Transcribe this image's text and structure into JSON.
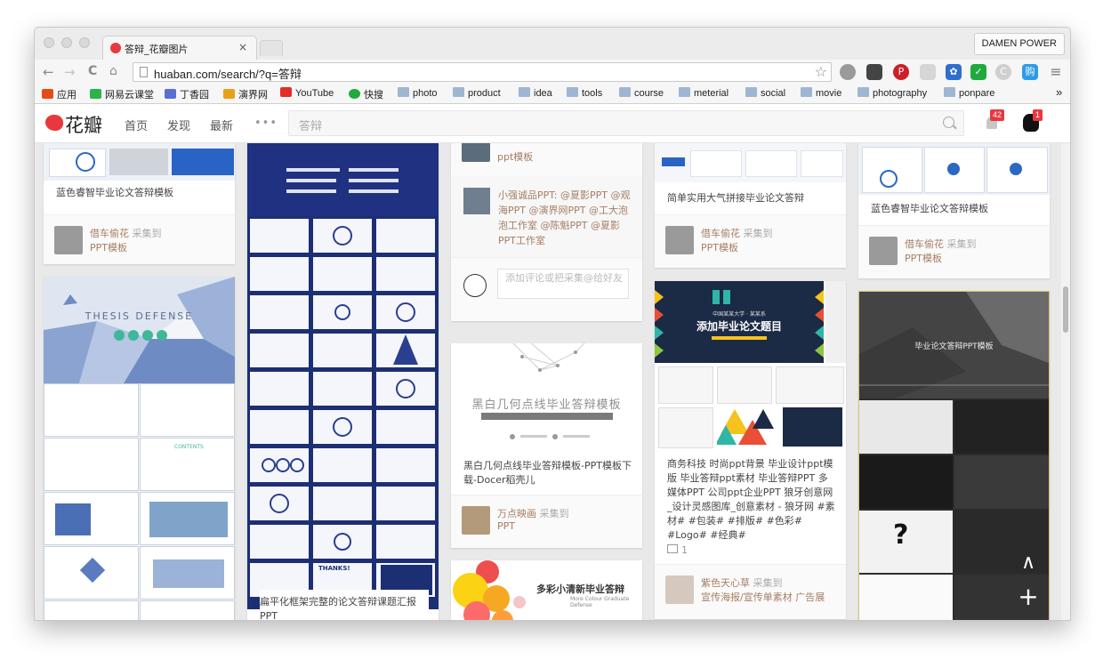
{
  "browser": {
    "tab_title": "答辩_花瓣图片",
    "tab_close": "×",
    "profile": "DAMEN POWER",
    "url": "huaban.com/search/?q=答辩",
    "nav": {
      "back": "←",
      "forward": "→",
      "reload": "C",
      "home": "⌂"
    },
    "star": "☆",
    "extensions": [
      {
        "name": "globe-icon",
        "color": "#8a8a8a"
      },
      {
        "name": "hand-icon",
        "color": "#555555"
      },
      {
        "name": "pinterest-icon",
        "color": "#cb2027"
      },
      {
        "name": "shield-icon",
        "color": "#d0d0d0"
      },
      {
        "name": "paw-icon",
        "color": "#2d6fd0"
      },
      {
        "name": "adblock-icon",
        "color": "#1faa3d"
      },
      {
        "name": "copyright-icon",
        "color": "#bbbbbb"
      },
      {
        "name": "gou-icon",
        "color": "#2f9be8"
      },
      {
        "name": "menu-icon",
        "color": "#777777"
      }
    ],
    "bookmarks": [
      {
        "label": "应用",
        "icon": "apps-icon",
        "color": "#e64a19"
      },
      {
        "label": "网易云课堂",
        "icon": "cloud-class-icon",
        "color": "#2db34a"
      },
      {
        "label": "丁香园",
        "icon": "dxy-icon",
        "color": "#5b6fcf"
      },
      {
        "label": "演界网",
        "icon": "yanjie-icon",
        "color": "#e8a21a"
      },
      {
        "label": "YouTube",
        "icon": "youtube-icon",
        "color": "#e52d27"
      },
      {
        "label": "快搜",
        "icon": "kuaisou-icon",
        "color": "#1faa3d"
      },
      {
        "label": "photo",
        "icon": "folder-icon"
      },
      {
        "label": "product",
        "icon": "folder-icon"
      },
      {
        "label": "idea",
        "icon": "folder-icon"
      },
      {
        "label": "tools",
        "icon": "folder-icon"
      },
      {
        "label": "course",
        "icon": "folder-icon"
      },
      {
        "label": "meterial",
        "icon": "folder-icon"
      },
      {
        "label": "social",
        "icon": "folder-icon"
      },
      {
        "label": "movie",
        "icon": "folder-icon"
      },
      {
        "label": "photography",
        "icon": "folder-icon"
      },
      {
        "label": "ponpare",
        "icon": "folder-icon"
      }
    ],
    "bookmarks_more": "»"
  },
  "huaban": {
    "logo": "花瓣",
    "nav": [
      "首页",
      "发现",
      "最新"
    ],
    "more": "•••",
    "search_placeholder": "答辩",
    "notif_count": "42",
    "msg_count": "1",
    "brand_color": "#e8383e"
  },
  "pins": {
    "c1a": {
      "caption": "蓝色睿智毕业论文答辩模板",
      "user": "借车偷花",
      "action": "采集到",
      "board": "PPT模板"
    },
    "c1b": {
      "headline": "THESIS DEFENSE",
      "sub": "CONTENTS"
    },
    "c2a": {
      "caption": "扁平化框架完整的论文答辩课题汇报PPT",
      "thanks": "THANKS!"
    },
    "c3a": {
      "board": "ppt模板"
    },
    "c3b": {
      "comment": "小强诚品PPT: @夏影PPT @观海PPT @演界网PPT @工大泡泡工作室 @陈魁PPT @夏影PPT工作室"
    },
    "c3c": {
      "placeholder": "添加评论或把采集@给好友"
    },
    "c3d": {
      "title": "黑白几何点线毕业答辩模板",
      "caption": "黑白几何点线毕业答辩模板-PPT模板下载-Docer稻壳儿",
      "user": "万点映画",
      "action": "采集到",
      "board": "PPT"
    },
    "c3e": {
      "title": "多彩小清新毕业答辩",
      "sub": "More Colour Graduate Defense"
    },
    "c4a": {
      "caption": "简单实用大气拼接毕业论文答辩",
      "user": "借车偷花",
      "action": "采集到",
      "board": "PPT模板"
    },
    "c4b": {
      "title": "添加毕业论文题目",
      "school": "中国某某大学 · 某某系",
      "caption": "商务科技 时尚ppt背景 毕业设计ppt模版 毕业答辩ppt素材 毕业答辩PPT 多媒体PPT 公司ppt企业PPT 狼牙创意网_设计灵感图库_创意素材 - 狼牙网 #素材# #包装# #排版# #色彩# #Logo# #经典#",
      "repins": "1",
      "user": "紫色天心草",
      "action": "采集到",
      "board": "宣传海报/宣传单素材 广告展"
    },
    "c5a": {
      "caption": "蓝色睿智毕业论文答辩模板",
      "user": "借车偷花",
      "action": "采集到",
      "board": "PPT模板"
    },
    "c5b": {
      "title": "毕业论文答辩PPT模板"
    }
  },
  "float_buttons": {
    "up": "∧",
    "add": "+"
  }
}
